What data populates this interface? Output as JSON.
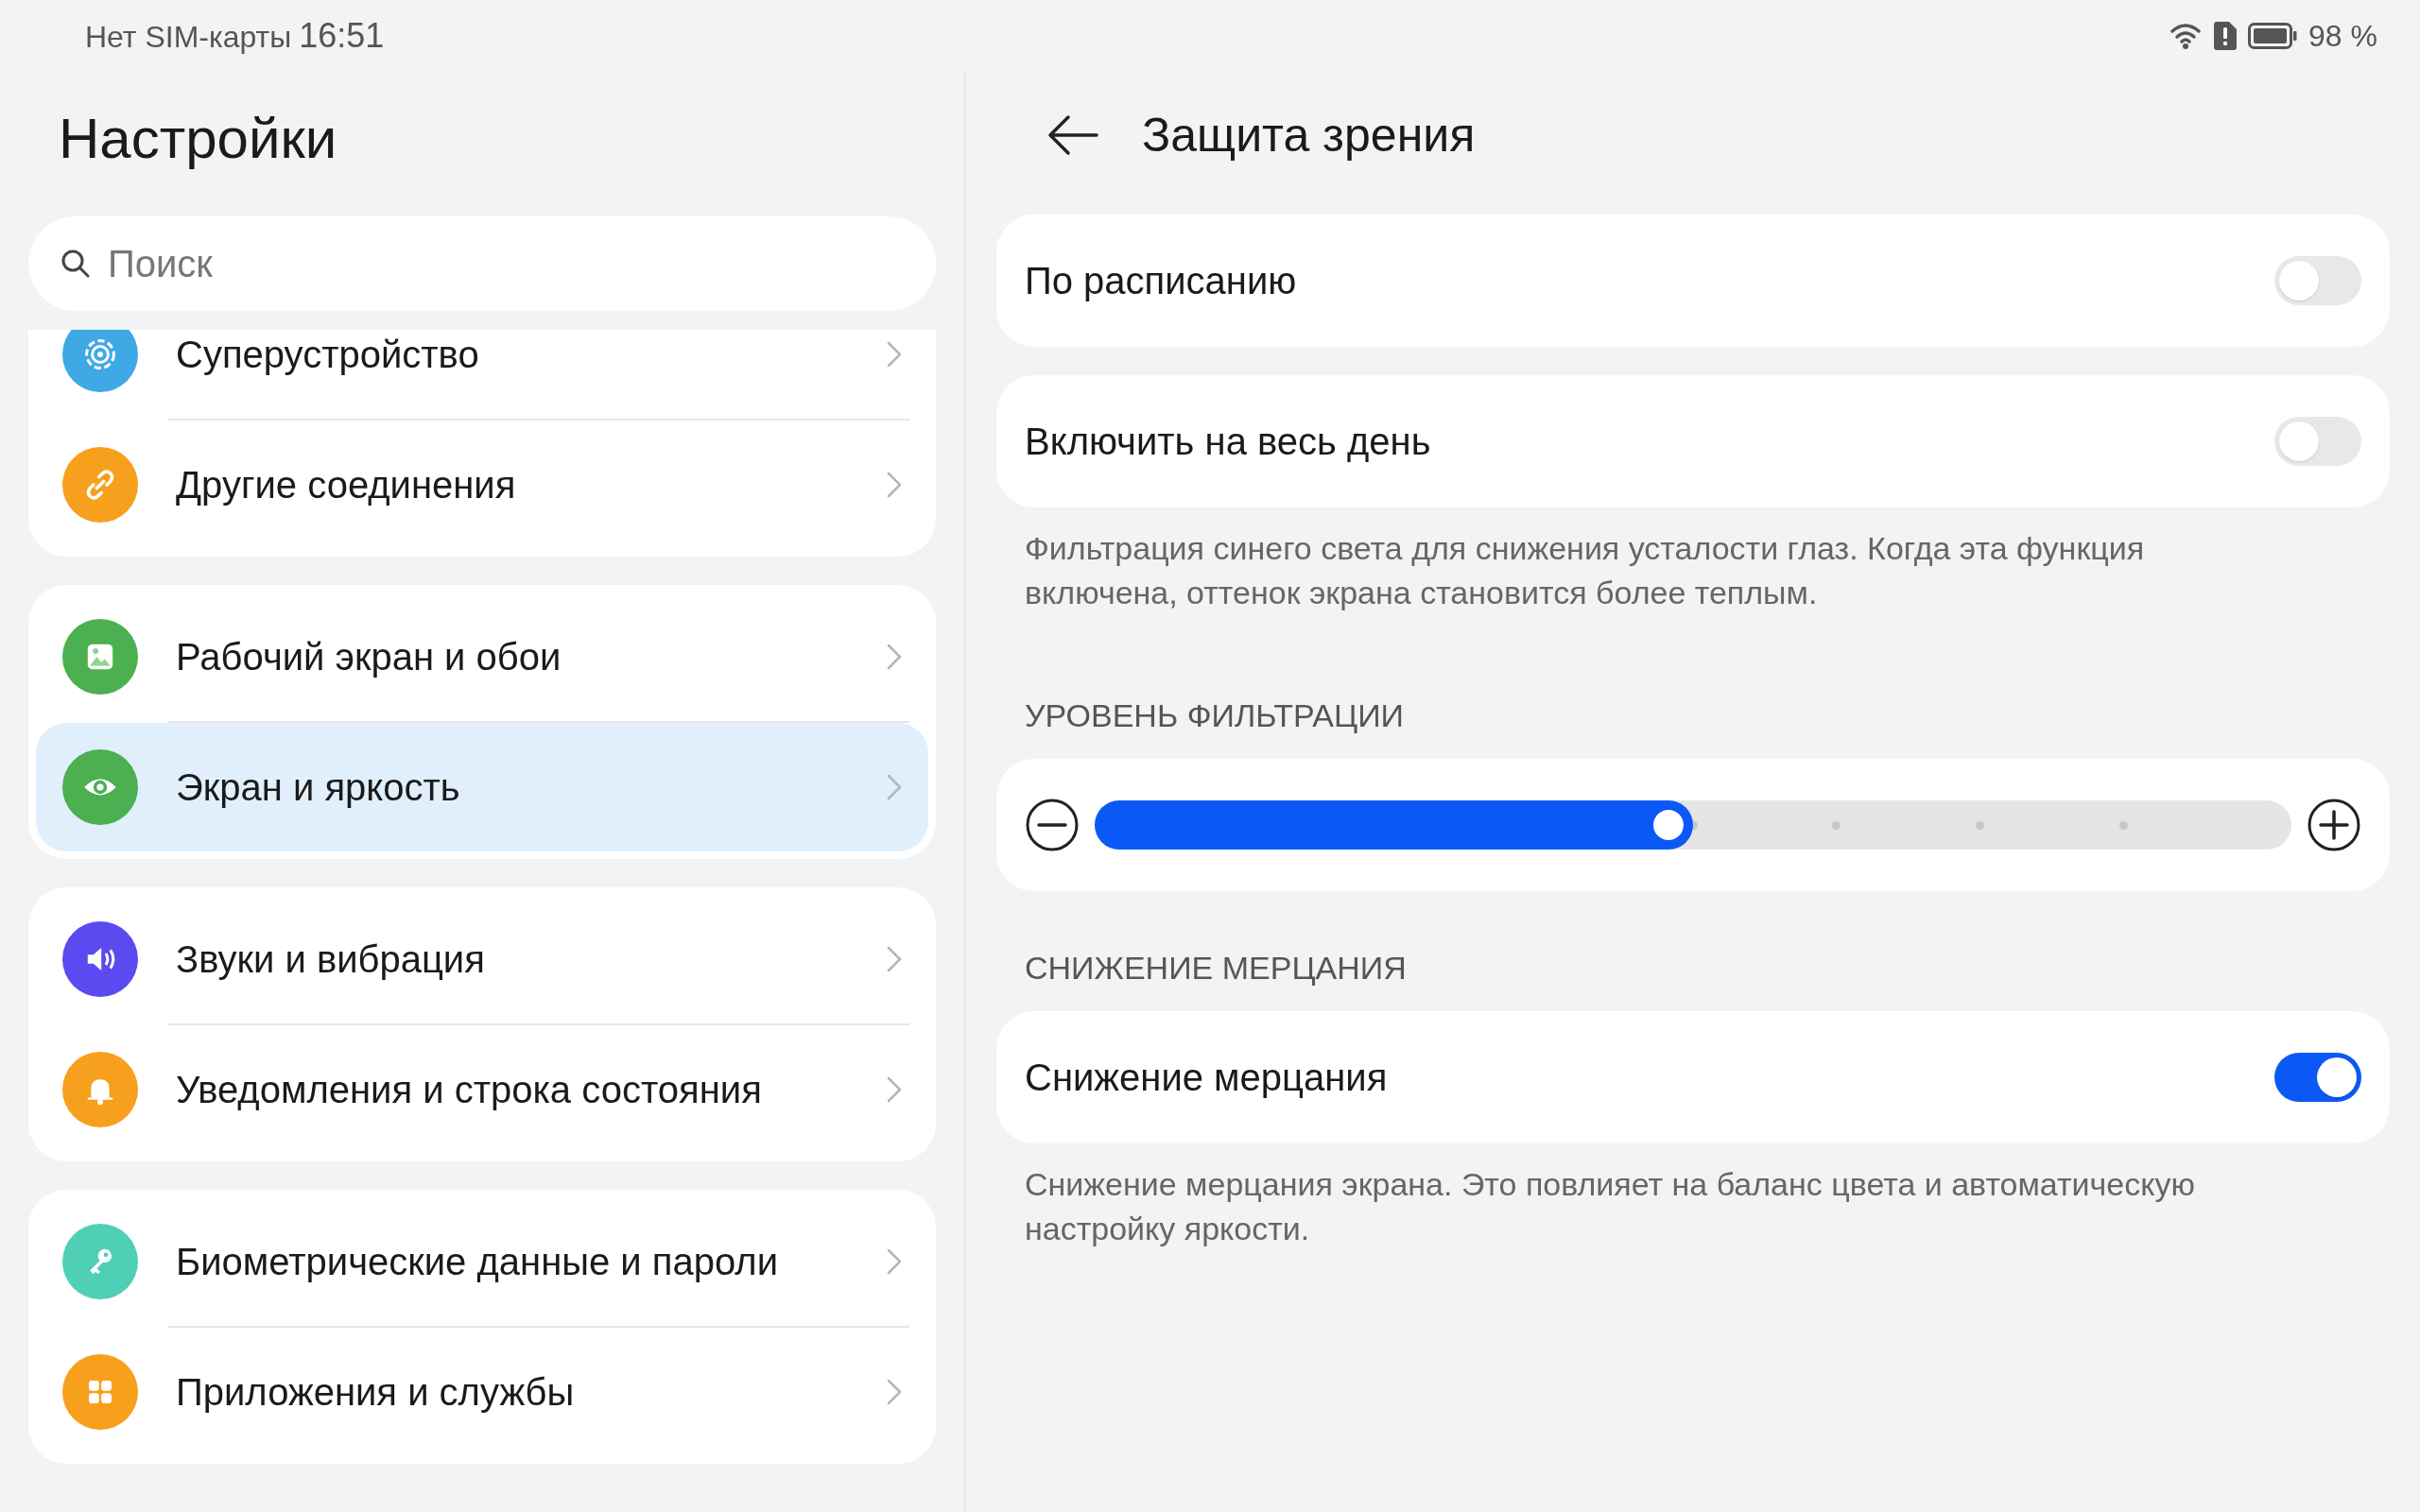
{
  "status_bar": {
    "carrier": "Нет SIM-карты",
    "time": "16:51",
    "battery": "98 %"
  },
  "sidebar": {
    "title": "Настройки",
    "search": {
      "placeholder": "Поиск"
    },
    "groups": [
      {
        "items": [
          {
            "label": "Суперустройство",
            "color": "#3fa9e6",
            "selected": false
          },
          {
            "label": "Другие соединения",
            "color": "#f7a01e",
            "selected": false
          }
        ]
      },
      {
        "items": [
          {
            "label": "Рабочий экран и обои",
            "color": "#4caf50",
            "selected": false
          },
          {
            "label": "Экран и яркость",
            "color": "#4caf50",
            "selected": true
          }
        ]
      },
      {
        "items": [
          {
            "label": "Звуки и вибрация",
            "color": "#5b4af0",
            "selected": false
          },
          {
            "label": "Уведомления и строка состояния",
            "color": "#f7a01e",
            "selected": false
          }
        ]
      },
      {
        "items": [
          {
            "label": "Биометрические данные и пароли",
            "color": "#4fcfb5",
            "selected": false
          },
          {
            "label": "Приложения и службы",
            "color": "#f7a01e",
            "selected": false
          }
        ]
      }
    ]
  },
  "page": {
    "title": "Защита зрения",
    "sections": [
      {
        "kind": "toggle",
        "label": "По расписанию",
        "on": false
      },
      {
        "kind": "toggle",
        "label": "Включить на весь день",
        "on": false
      },
      {
        "kind": "note",
        "text": "Фильтрация синего света для снижения усталости глаз. Когда эта функция включена, оттенок экрана становится более теплым."
      },
      {
        "kind": "heading",
        "text": "УРОВЕНЬ ФИЛЬТРАЦИИ"
      },
      {
        "kind": "slider",
        "level": 0.5
      },
      {
        "kind": "heading",
        "text": "СНИЖЕНИЕ МЕРЦАНИЯ"
      },
      {
        "kind": "toggle",
        "label": "Снижение мерцания",
        "on": true
      },
      {
        "kind": "note",
        "text": "Снижение мерцания экрана. Это повлияет на баланс цвета и автоматическую настройку яркости."
      }
    ]
  }
}
